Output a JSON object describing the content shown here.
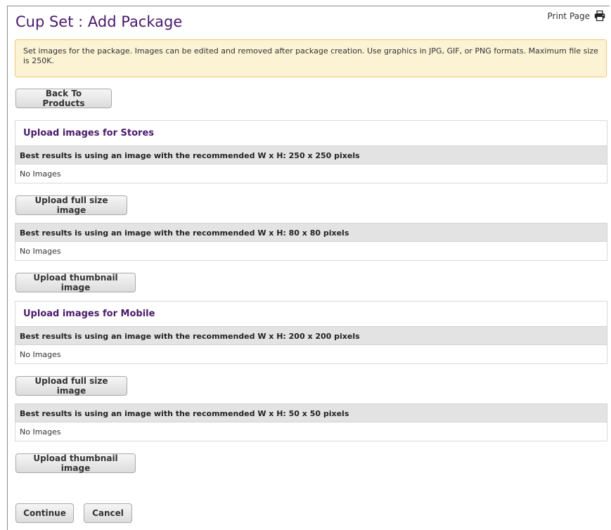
{
  "page": {
    "title": "Cup Set : Add Package",
    "print_label": "Print Page",
    "notice": "Set images for the package. Images can be edited and removed after package creation. Use graphics in JPG, GIF, or PNG formats. Maximum file size is 250K.",
    "back_label": "Back To Products"
  },
  "stores": {
    "heading": "Upload images for Stores",
    "full": {
      "hint": "Best results is using an image with the recommended W x H: 250 x 250 pixels",
      "status": "No Images",
      "button": "Upload full size image"
    },
    "thumb": {
      "hint": "Best results is using an image with the recommended W x H: 80 x 80 pixels",
      "status": "No Images",
      "button": "Upload thumbnail image"
    }
  },
  "mobile": {
    "heading": "Upload images for Mobile",
    "full": {
      "hint": "Best results is using an image with the recommended W x H: 200 x 200 pixels",
      "status": "No Images",
      "button": "Upload full size image"
    },
    "thumb": {
      "hint": "Best results is using an image with the recommended W x H: 50 x 50 pixels",
      "status": "No Images",
      "button": "Upload thumbnail image"
    }
  },
  "footer": {
    "continue_label": "Continue",
    "cancel_label": "Cancel"
  },
  "icons": {
    "print": "printer-icon"
  }
}
